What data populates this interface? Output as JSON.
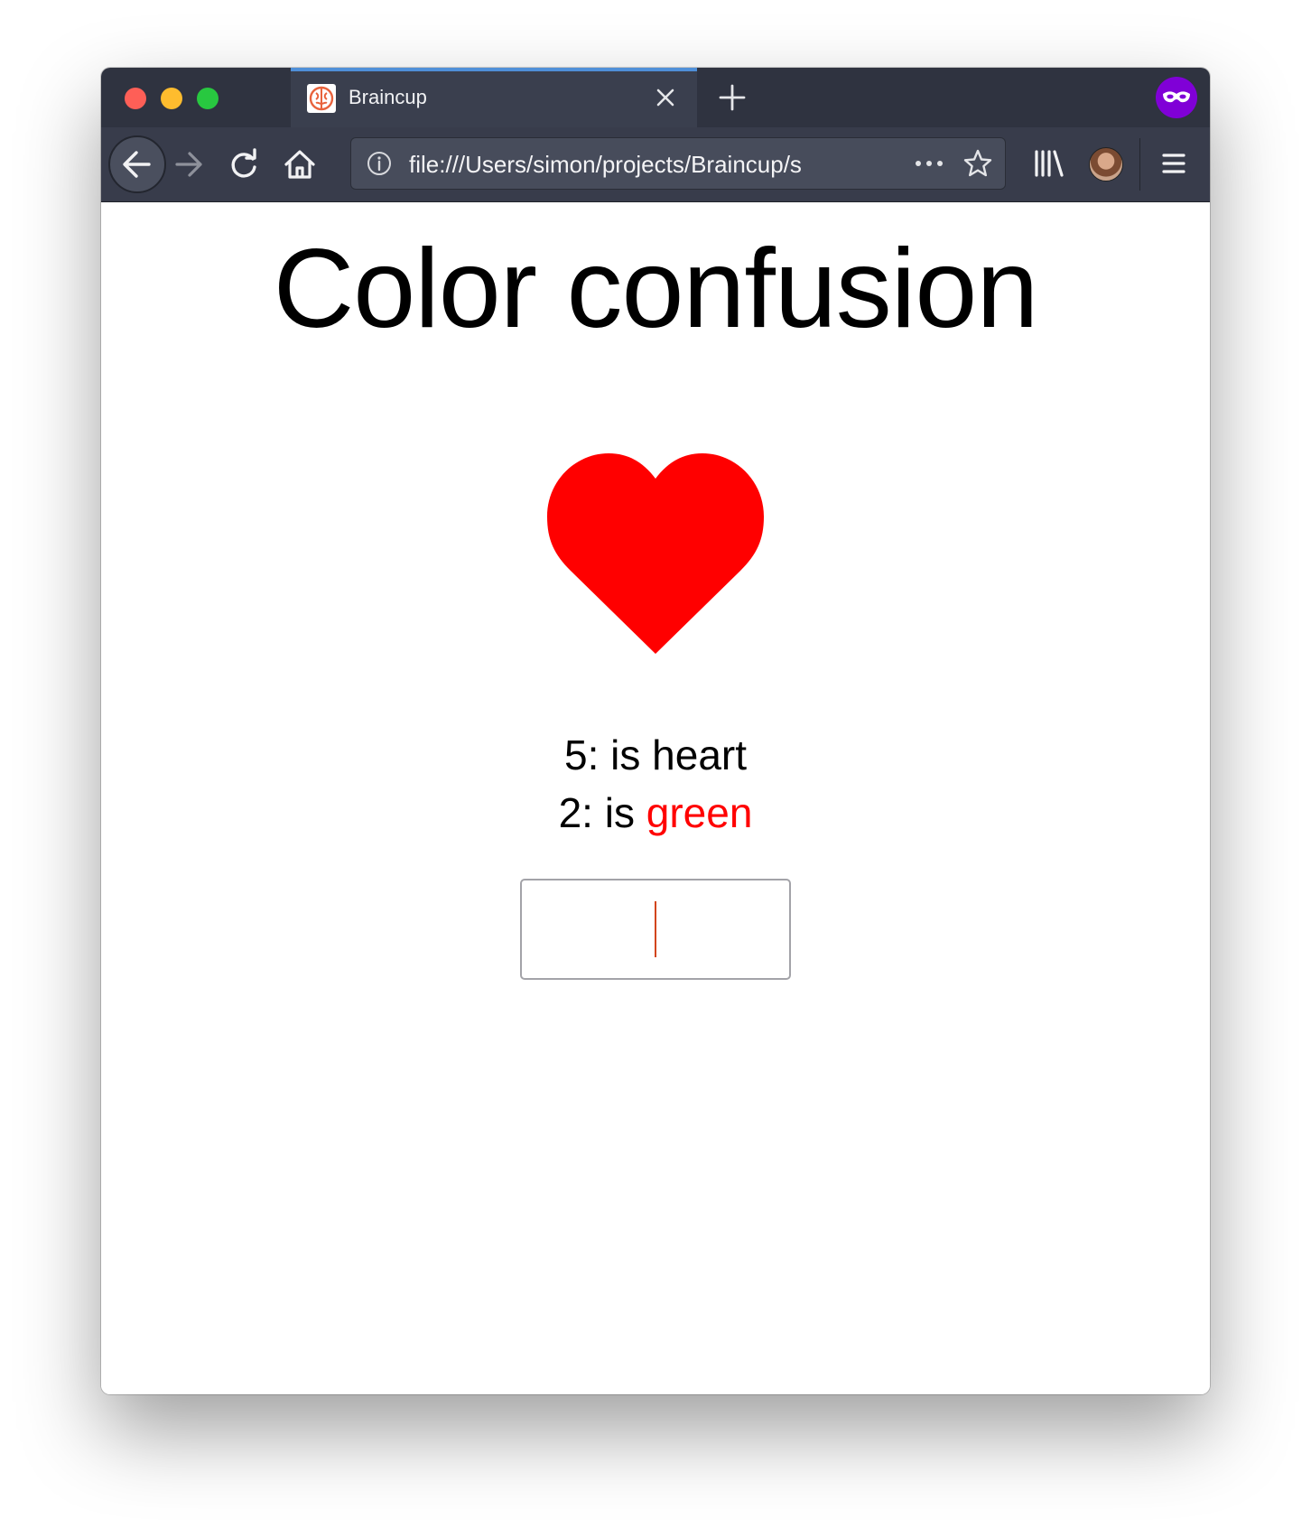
{
  "browser": {
    "tab": {
      "title": "Braincup"
    },
    "url": "file:///Users/simon/projects/Braincup/s",
    "icons": {
      "close_tab": "close-icon",
      "new_tab": "plus-icon",
      "private": "private-browsing-mask-icon",
      "back": "arrow-left-icon",
      "forward": "arrow-right-icon",
      "reload": "reload-icon",
      "home": "home-icon",
      "page_info": "info-icon",
      "page_actions": "more-horizontal-icon",
      "bookmark": "star-icon",
      "library": "library-icon",
      "account": "avatar",
      "menu": "hamburger-menu-icon"
    },
    "colors": {
      "tab_accent": "#4f8fd8",
      "private_badge": "#8000d7"
    }
  },
  "page": {
    "title": "Color confusion",
    "shape": {
      "name": "heart",
      "color": "#ff0000"
    },
    "clues": [
      {
        "number": "5:",
        "text": "is",
        "term": "heart",
        "term_color": "#000000"
      },
      {
        "number": "2:",
        "text": "is",
        "term": "green",
        "term_color": "#ff0000"
      }
    ],
    "answer_input": {
      "value": ""
    }
  }
}
